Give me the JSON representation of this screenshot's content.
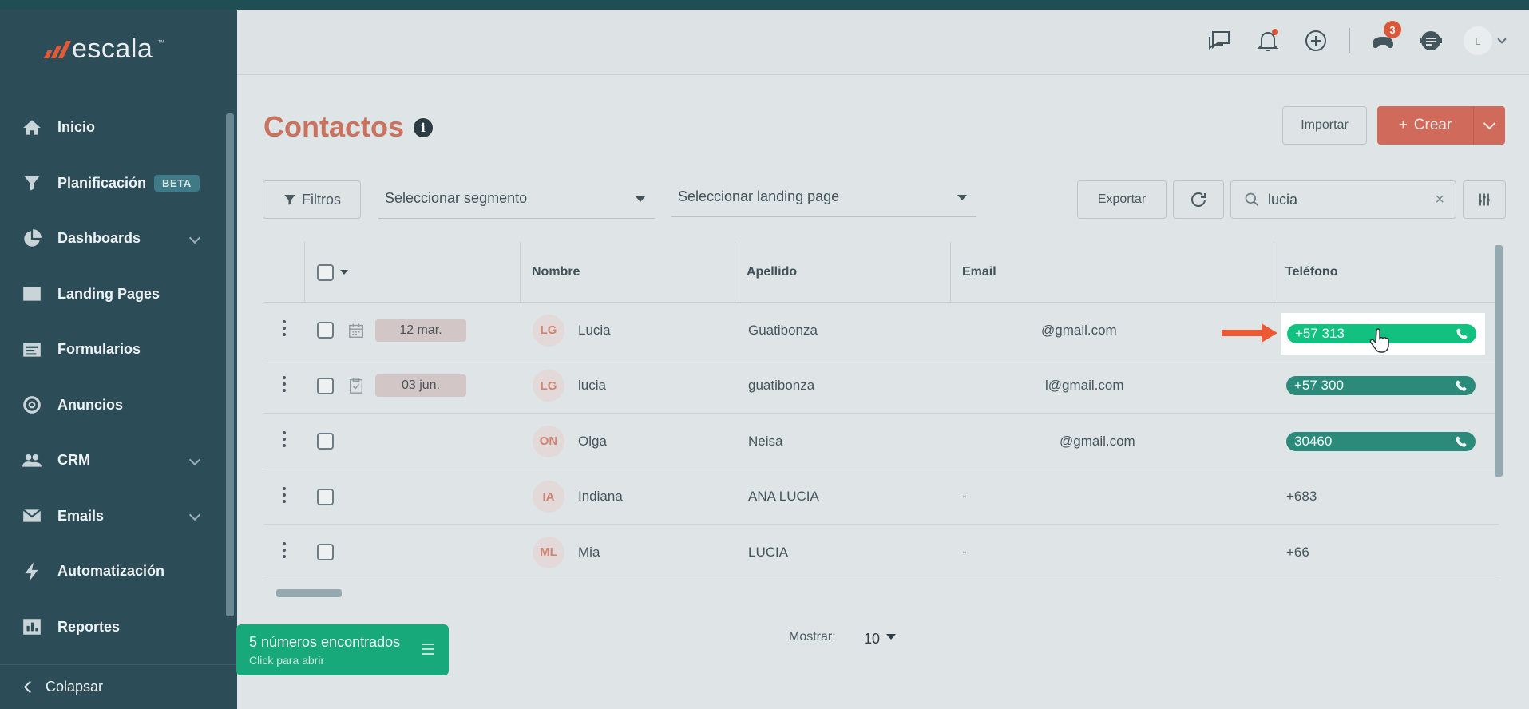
{
  "sidebar": {
    "logo_text": "escala",
    "logo_tm": "™",
    "items": [
      {
        "label": "Inicio",
        "icon": "home-icon"
      },
      {
        "label": "Planificación",
        "badge": "BETA",
        "icon": "funnel-icon"
      },
      {
        "label": "Dashboards",
        "icon": "pie-chart-icon",
        "expandable": true
      },
      {
        "label": "Landing Pages",
        "icon": "browser-window-icon"
      },
      {
        "label": "Formularios",
        "icon": "form-icon"
      },
      {
        "label": "Anuncios",
        "icon": "target-icon"
      },
      {
        "label": "CRM",
        "icon": "people-icon",
        "expandable": true
      },
      {
        "label": "Emails",
        "icon": "envelope-icon",
        "expandable": true
      },
      {
        "label": "Automatización",
        "icon": "lightning-icon"
      },
      {
        "label": "Reportes",
        "icon": "bar-report-icon"
      }
    ],
    "collapse_label": "Colapsar"
  },
  "header": {
    "badge_count": "3",
    "avatar_initial": "L"
  },
  "page": {
    "title": "Contactos",
    "info_glyph": "i",
    "import_label": "Importar",
    "create_label": "Crear",
    "create_plus": "+"
  },
  "toolbar": {
    "filters_label": "Filtros",
    "segment_placeholder": "Seleccionar segmento",
    "landing_placeholder": "Seleccionar landing page",
    "export_label": "Exportar",
    "search_value": "lucia",
    "clear_glyph": "×"
  },
  "table": {
    "columns": [
      "Nombre",
      "Apellido",
      "Email",
      "Teléfono"
    ],
    "rows": [
      {
        "date": "12 mar.",
        "initials": "LG",
        "nombre": "Lucia",
        "apellido": "Guatibonza",
        "email": "@gmail.com",
        "telefono": "+57 313",
        "phone_pill": "bright"
      },
      {
        "date": "03 jun.",
        "initials": "LG",
        "nombre": "lucia",
        "apellido": "guatibonza",
        "email": "l@gmail.com",
        "telefono": "+57 300",
        "phone_pill": "dim"
      },
      {
        "date": "",
        "initials": "ON",
        "nombre": "Olga",
        "apellido": "Neisa",
        "email": "@gmail.com",
        "telefono": "30460",
        "phone_pill": "dim"
      },
      {
        "date": "",
        "initials": "IA",
        "nombre": "Indiana",
        "apellido": "ANA LUCIA",
        "email": "-",
        "telefono": "+683",
        "phone_pill": ""
      },
      {
        "date": "",
        "initials": "ML",
        "nombre": "Mia",
        "apellido": "LUCIA",
        "email": "-",
        "telefono": "+66",
        "phone_pill": ""
      }
    ]
  },
  "found_banner": {
    "line1": "5 números encontrados",
    "line2": "Click para abrir"
  },
  "pagination": {
    "show_label": "Mostrar:",
    "show_value": "10"
  },
  "colors": {
    "sidebar_bg": "#2c4c58",
    "title_accent": "#c9735e",
    "create_button": "#d06b5c",
    "phone_green": "#12c07f",
    "found_banner": "#18a97a",
    "arrow": "#ec5a35"
  }
}
